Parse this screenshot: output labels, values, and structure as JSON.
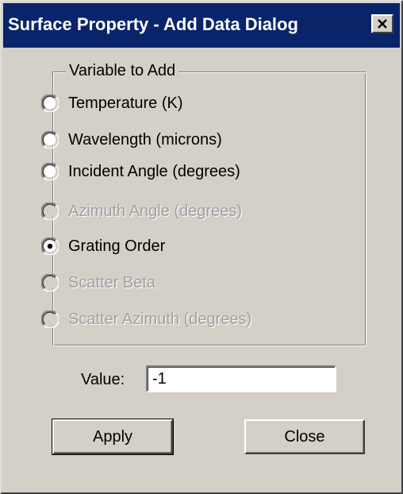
{
  "window": {
    "title": "Surface Property - Add Data Dialog"
  },
  "variable_group": {
    "legend": "Variable to Add",
    "options": [
      {
        "label": "Temperature (K)",
        "selected": false,
        "enabled": true
      },
      {
        "label": "Wavelength (microns)",
        "selected": false,
        "enabled": true
      },
      {
        "label": "Incident Angle (degrees)",
        "selected": false,
        "enabled": true
      },
      {
        "label": "Azimuth Angle (degrees)",
        "selected": false,
        "enabled": false
      },
      {
        "label": "Grating Order",
        "selected": true,
        "enabled": true
      },
      {
        "label": "Scatter Beta",
        "selected": false,
        "enabled": false
      },
      {
        "label": "Scatter Azimuth (degrees)",
        "selected": false,
        "enabled": false
      }
    ]
  },
  "value_field": {
    "label": "Value:",
    "value": "-1"
  },
  "buttons": {
    "apply_label": "Apply",
    "close_label": "Close"
  },
  "icons": {
    "close": "close-icon",
    "radio": "radio-button-icon"
  },
  "colors": {
    "titlebar": "#0a246a",
    "face": "#d4d0c8",
    "disabled_text": "#a0a0a0"
  }
}
